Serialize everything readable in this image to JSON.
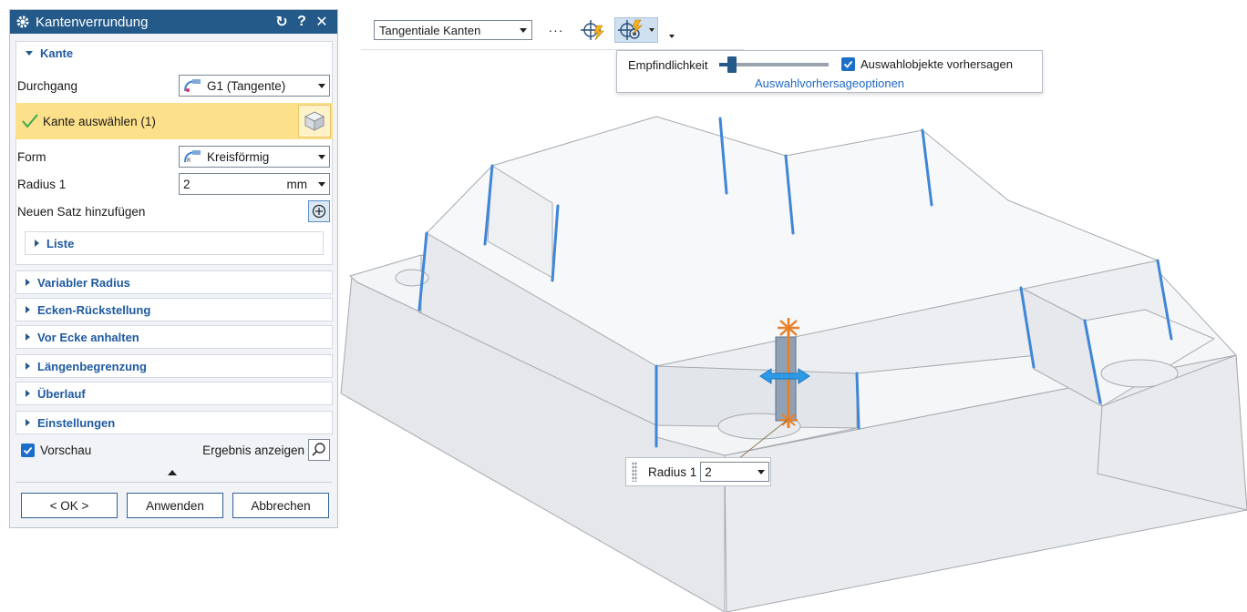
{
  "dialog": {
    "title": "Kantenverrundung",
    "section_kante": "Kante",
    "durchgang_label": "Durchgang",
    "durchgang_value": "G1 (Tangente)",
    "select_label": "Kante auswählen (1)",
    "form_label": "Form",
    "form_value": "Kreisförmig",
    "radius_label": "Radius 1",
    "radius_value": "2",
    "radius_unit": "mm",
    "add_set_label": "Neuen Satz hinzufügen",
    "list_label": "Liste",
    "collapsed_sections": [
      "Variabler Radius",
      "Ecken-Rückstellung",
      "Vor Ecke anhalten",
      "Längenbegrenzung",
      "Überlauf",
      "Einstellungen"
    ],
    "preview_label": "Vorschau",
    "show_result_label": "Ergebnis anzeigen",
    "ok_label": "< OK >",
    "apply_label": "Anwenden",
    "cancel_label": "Abbrechen"
  },
  "toolbar": {
    "filter_value": "Tangentiale Kanten",
    "more_label": "···"
  },
  "popup": {
    "sensitivity_label": "Empfindlichkeit",
    "sensitivity_level": 0.12,
    "predict_label": "Auswahlobjekte vorhersagen",
    "options_link": "Auswahlvorhersageoptionen"
  },
  "viewport_tip": {
    "label": "Radius 1",
    "value": "2"
  },
  "colors": {
    "titlebar": "#245a8a",
    "accent": "#1c6fc8",
    "highlight": "#fde08a",
    "edge": "#3f86d6",
    "handle": "#e8802a"
  }
}
